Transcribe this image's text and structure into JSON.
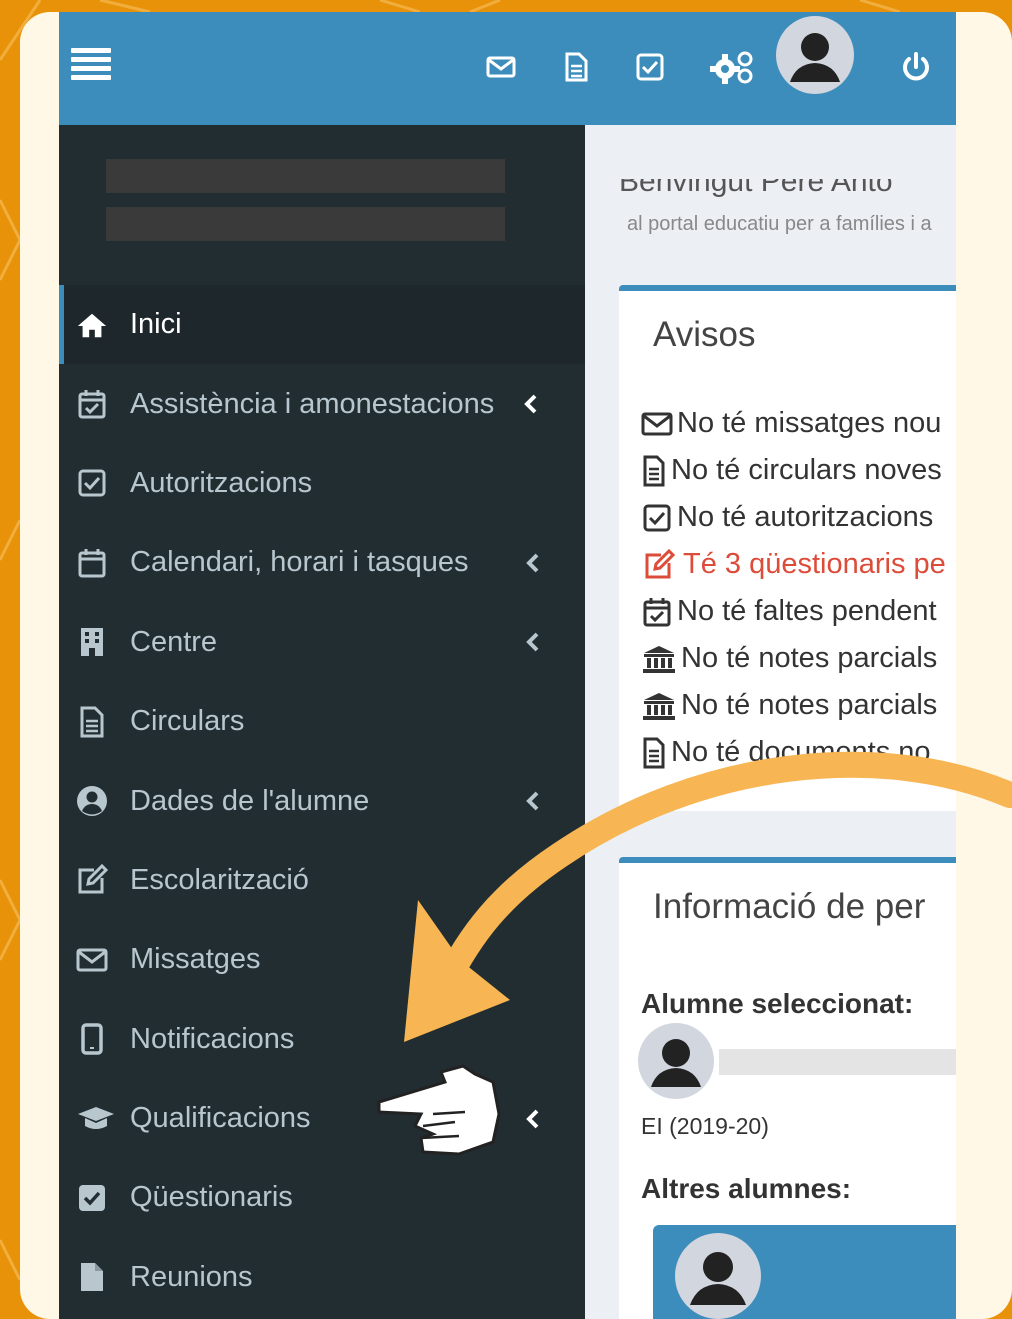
{
  "topbar": {
    "menu_icon": "hamburger-icon",
    "icons": [
      "envelope-icon",
      "file-icon",
      "check-square-icon",
      "cogs-icon",
      "user-avatar",
      "power-icon"
    ]
  },
  "sidebar": {
    "items": [
      {
        "label": "Inici",
        "icon": "home-icon",
        "active": true
      },
      {
        "label": "Assistència i amonestacions",
        "icon": "calendar-check-icon",
        "submenu": true
      },
      {
        "label": "Autoritzacions",
        "icon": "check-square-icon"
      },
      {
        "label": "Calendari, horari i tasques",
        "icon": "calendar-icon",
        "submenu": true
      },
      {
        "label": "Centre",
        "icon": "building-icon",
        "submenu": true
      },
      {
        "label": "Circulars",
        "icon": "file-icon"
      },
      {
        "label": "Dades de l'alumne",
        "icon": "user-circle-icon",
        "submenu": true
      },
      {
        "label": "Escolarització",
        "icon": "edit-icon"
      },
      {
        "label": "Missatges",
        "icon": "envelope-icon"
      },
      {
        "label": "Notificacions",
        "icon": "mobile-icon"
      },
      {
        "label": "Qualificacions",
        "icon": "graduation-cap-icon",
        "submenu": true
      },
      {
        "label": "Qüestionaris",
        "icon": "check-square-solid-icon"
      },
      {
        "label": "Reunions",
        "icon": "file-solid-icon"
      }
    ]
  },
  "main": {
    "welcome_title": "Benvingut Pere Anto",
    "welcome_subtitle": "al portal educatiu per a famílies i a",
    "notices_title": "Avisos",
    "notices": [
      {
        "text": "No té missatges nou",
        "icon": "envelope-icon"
      },
      {
        "text": "No té circulars noves",
        "icon": "file-icon"
      },
      {
        "text": "No té autoritzacions",
        "icon": "check-square-icon"
      },
      {
        "text": "Té 3 qüestionaris pe",
        "icon": "edit-icon",
        "highlight": true
      },
      {
        "text": "No té faltes pendent",
        "icon": "calendar-check-icon"
      },
      {
        "text": "No té notes parcials",
        "icon": "bank-icon"
      },
      {
        "text": "No té notes parcials",
        "icon": "bank-icon"
      },
      {
        "text": "No té documents no",
        "icon": "file-icon"
      }
    ],
    "profile_title": "Informació de per",
    "selected_label": "Alumne seleccionat:",
    "course": "EI (2019-20)",
    "others_label": "Altres alumnes:"
  },
  "colors": {
    "frame_orange": "#e8920a",
    "topbar_blue": "#3c8dbc",
    "sidebar_dark": "#222d32",
    "highlight_red": "#dd4b39",
    "arrow_orange": "#f7b553"
  }
}
